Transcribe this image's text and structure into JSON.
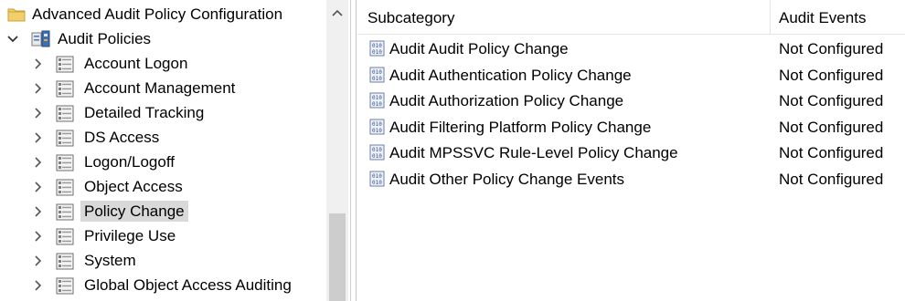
{
  "tree": {
    "root": {
      "label": "Advanced Audit Policy Configuration",
      "icon": "folder-icon"
    },
    "parent": {
      "label": "Audit Policies",
      "icon": "audit-policies-icon",
      "expanded": true
    },
    "items": [
      {
        "label": "Account Logon",
        "selected": false
      },
      {
        "label": "Account Management",
        "selected": false
      },
      {
        "label": "Detailed Tracking",
        "selected": false
      },
      {
        "label": "DS Access",
        "selected": false
      },
      {
        "label": "Logon/Logoff",
        "selected": false
      },
      {
        "label": "Object Access",
        "selected": false
      },
      {
        "label": "Policy Change",
        "selected": true
      },
      {
        "label": "Privilege Use",
        "selected": false
      },
      {
        "label": "System",
        "selected": false
      },
      {
        "label": "Global Object Access Auditing",
        "selected": false
      }
    ]
  },
  "list": {
    "columns": {
      "subcategory": "Subcategory",
      "audit_events": "Audit Events"
    },
    "rows": [
      {
        "subcategory": "Audit Audit Policy Change",
        "audit_events": "Not Configured"
      },
      {
        "subcategory": "Audit Authentication Policy Change",
        "audit_events": "Not Configured"
      },
      {
        "subcategory": "Audit Authorization Policy Change",
        "audit_events": "Not Configured"
      },
      {
        "subcategory": "Audit Filtering Platform Policy Change",
        "audit_events": "Not Configured"
      },
      {
        "subcategory": "Audit MPSSVC Rule-Level Policy Change",
        "audit_events": "Not Configured"
      },
      {
        "subcategory": "Audit Other Policy Change Events",
        "audit_events": "Not Configured"
      }
    ]
  },
  "colors": {
    "selection": "#d9d9d9",
    "scrollbar_track": "#f0f0f0",
    "scrollbar_thumb": "#cdcdcd"
  }
}
